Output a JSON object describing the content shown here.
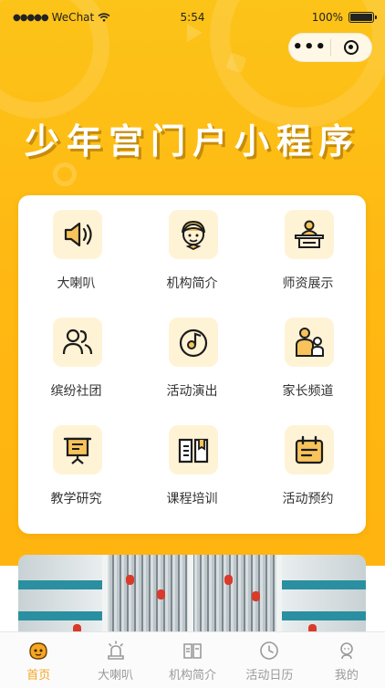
{
  "status_bar": {
    "carrier": "WeChat",
    "signal_dots": "●●●●●",
    "time": "5:54",
    "battery": "100%"
  },
  "capsule": {
    "more_label": "•••"
  },
  "page_title": "少年宫门户小程序",
  "grid": [
    {
      "label": "大喇叭",
      "icon": "speaker-icon"
    },
    {
      "label": "机构简介",
      "icon": "mascot-icon"
    },
    {
      "label": "师资展示",
      "icon": "teacher-podium-icon"
    },
    {
      "label": "缤纷社团",
      "icon": "group-people-icon"
    },
    {
      "label": "活动演出",
      "icon": "music-disc-icon"
    },
    {
      "label": "家长频道",
      "icon": "parent-child-icon"
    },
    {
      "label": "教学研究",
      "icon": "presentation-board-icon"
    },
    {
      "label": "课程培训",
      "icon": "open-book-icon"
    },
    {
      "label": "活动预约",
      "icon": "calendar-icon"
    }
  ],
  "tabs": [
    {
      "label": "首页",
      "icon": "home-mascot-icon",
      "active": true
    },
    {
      "label": "大喇叭",
      "icon": "alarm-icon",
      "active": false
    },
    {
      "label": "机构简介",
      "icon": "book-icon",
      "active": false
    },
    {
      "label": "活动日历",
      "icon": "clock-icon",
      "active": false
    },
    {
      "label": "我的",
      "icon": "profile-icon",
      "active": false
    }
  ],
  "colors": {
    "hero_bg": "#fcc318",
    "icon_bg": "#fff3d6",
    "icon_accent": "#f7c35a",
    "tab_active": "#f5a623",
    "tab_inactive": "#9a9a9a"
  }
}
